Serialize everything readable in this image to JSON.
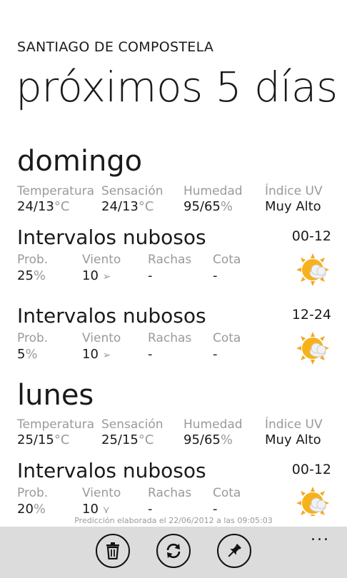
{
  "header": {
    "city": "SANTIAGO DE COMPOSTELA",
    "title": "próximos 5 días"
  },
  "summary_labels": {
    "temperatura": "Temperatura",
    "sensacion": "Sensación",
    "humedad": "Humedad",
    "uv": "Índice UV"
  },
  "period_labels": {
    "prob": "Prob.",
    "viento": "Viento",
    "rachas": "Rachas",
    "cota": "Cota"
  },
  "units": {
    "temp": "°C",
    "percent": "%"
  },
  "days": [
    {
      "name": "domingo",
      "temperatura": "24/13",
      "sensacion": "24/13",
      "humedad": "95/65",
      "uv": "Muy Alto",
      "periods": [
        {
          "condition": "Intervalos nubosos",
          "range": "00-12",
          "prob": "25",
          "viento": "10",
          "viento_arrow": "➢",
          "rachas": "-",
          "cota": "-",
          "icon": "partly-cloudy-icon"
        },
        {
          "condition": "Intervalos nubosos",
          "range": "12-24",
          "prob": "5",
          "viento": "10",
          "viento_arrow": "➢",
          "rachas": "-",
          "cota": "-",
          "icon": "partly-cloudy-icon"
        }
      ]
    },
    {
      "name": "lunes",
      "temperatura": "25/15",
      "sensacion": "25/15",
      "humedad": "95/65",
      "uv": "Muy Alto",
      "periods": [
        {
          "condition": "Intervalos nubosos",
          "range": "00-12",
          "prob": "20",
          "viento": "10",
          "viento_arrow": "⋎",
          "rachas": "-",
          "cota": "-",
          "icon": "partly-cloudy-icon"
        }
      ]
    }
  ],
  "footer": {
    "note": "Predicción elaborada el 22/06/2012 a las 09:05:03",
    "more": "..."
  },
  "appbar": {
    "buttons": [
      "delete-icon",
      "refresh-icon",
      "pin-icon"
    ]
  }
}
